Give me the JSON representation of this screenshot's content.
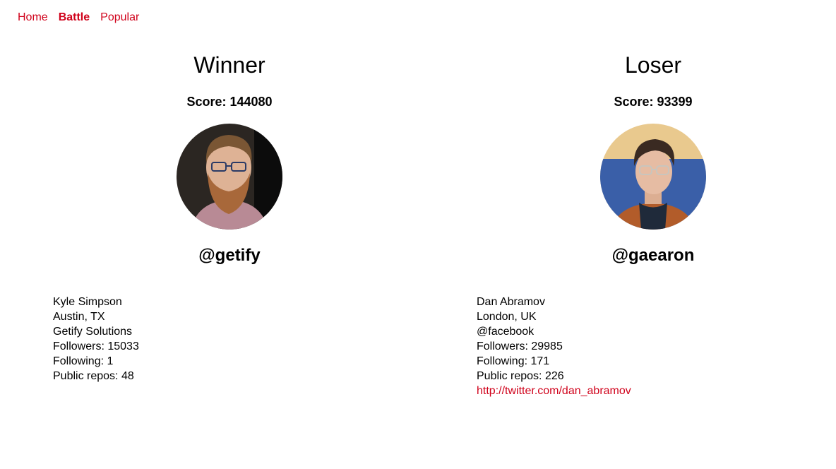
{
  "nav": {
    "home": "Home",
    "battle": "Battle",
    "popular": "Popular"
  },
  "winner": {
    "title": "Winner",
    "score": "Score: 144080",
    "username": "@getify",
    "avatar_icon": "avatar-kyle-simpson",
    "details": {
      "name": "Kyle Simpson",
      "location": "Austin, TX",
      "company": "Getify Solutions",
      "followers": "Followers: 15033",
      "following": "Following: 1",
      "repos": "Public repos: 48"
    }
  },
  "loser": {
    "title": "Loser",
    "score": "Score: 93399",
    "username": "@gaearon",
    "avatar_icon": "avatar-dan-abramov",
    "details": {
      "name": "Dan Abramov",
      "location": "London, UK",
      "company": "@facebook",
      "followers": "Followers: 29985",
      "following": "Following: 171",
      "repos": "Public repos: 226",
      "blog": "http://twitter.com/dan_abramov"
    }
  },
  "colors": {
    "link": "#d0021b"
  }
}
